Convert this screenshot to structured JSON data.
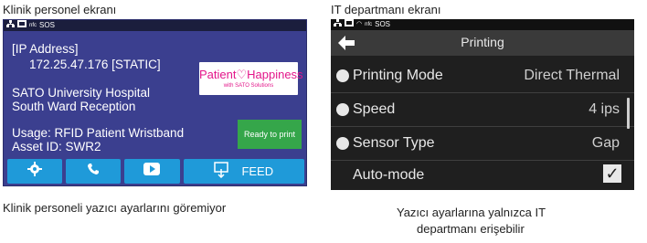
{
  "captions": {
    "left_title": "Klinik personel ekranı",
    "right_title": "IT departmanı ekranı",
    "left_bottom": "Klinik personeli yazıcı ayarlarını göremiyor",
    "right_bottom_line1": "Yazıcı ayarlarına yalnızca IT",
    "right_bottom_line2": "departmanı erişebilir"
  },
  "left": {
    "status": "SOS",
    "ip_label": "[IP Address]",
    "ip_value": "172.25.47.176 [STATIC]",
    "hospital": "SATO University Hospital",
    "reception": "South Ward Reception",
    "usage": "Usage: RFID Patient Wristband",
    "asset": "Asset ID: SWR2",
    "logo_main": "Patient♡Happiness",
    "logo_sub": "with SATO Solutions",
    "ready": "Ready to print",
    "feed": "FEED",
    "colors": {
      "bg": "#3b3f8f",
      "button": "#1f9ad9",
      "ready": "#35a64a",
      "logo": "#e3168a"
    }
  },
  "right": {
    "status": "SOS",
    "title": "Printing",
    "rows": [
      {
        "label": "Printing Mode",
        "value": "Direct Thermal"
      },
      {
        "label": "Speed",
        "value": "4 ips"
      },
      {
        "label": "Sensor Type",
        "value": "Gap"
      },
      {
        "label": "Auto-mode",
        "value": ""
      }
    ],
    "auto_mode_checked": true
  }
}
